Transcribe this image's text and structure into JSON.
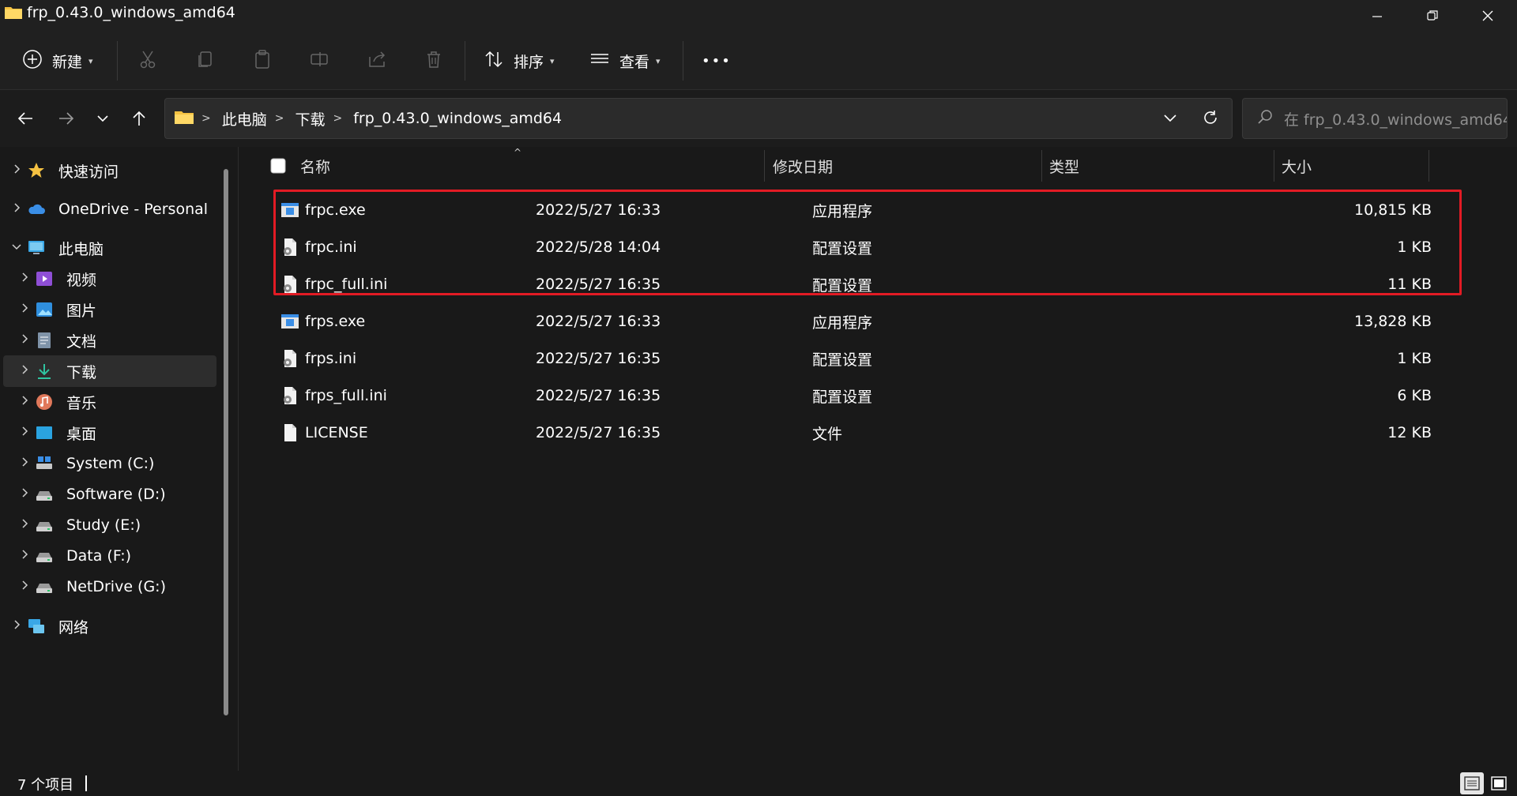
{
  "window": {
    "title": "frp_0.43.0_windows_amd64",
    "minimize_glyph": "—",
    "maximize_glyph": "❐",
    "close_glyph": "✕"
  },
  "toolbar": {
    "new_label": "新建",
    "sort_label": "排序",
    "view_label": "查看",
    "more_label": "•••",
    "chevron": "⌄"
  },
  "address": {
    "crumbs": [
      "此电脑",
      "下载",
      "frp_0.43.0_windows_amd64"
    ],
    "separator": ">",
    "search_placeholder": "在 frp_0.43.0_windows_amd64..."
  },
  "sidebar": {
    "items": [
      {
        "label": "快速访问",
        "icon": "star-icon",
        "expanded": false
      },
      {
        "label": "OneDrive - Personal",
        "icon": "cloud-icon",
        "expanded": false
      },
      {
        "label": "此电脑",
        "icon": "computer-icon",
        "expanded": true
      },
      {
        "label": "视频",
        "icon": "video-icon",
        "expanded": false
      },
      {
        "label": "图片",
        "icon": "pictures-icon",
        "expanded": false
      },
      {
        "label": "文档",
        "icon": "documents-icon",
        "expanded": false
      },
      {
        "label": "下载",
        "icon": "download-icon",
        "expanded": false,
        "selected": true
      },
      {
        "label": "音乐",
        "icon": "music-icon",
        "expanded": false
      },
      {
        "label": "桌面",
        "icon": "desktop-icon",
        "expanded": false
      },
      {
        "label": "System (C:)",
        "icon": "system-drive-icon",
        "expanded": false
      },
      {
        "label": "Software (D:)",
        "icon": "drive-icon",
        "expanded": false
      },
      {
        "label": "Study (E:)",
        "icon": "drive-icon",
        "expanded": false
      },
      {
        "label": "Data (F:)",
        "icon": "drive-icon",
        "expanded": false
      },
      {
        "label": "NetDrive (G:)",
        "icon": "drive-icon",
        "expanded": false
      },
      {
        "label": "网络",
        "icon": "network-icon",
        "expanded": false
      }
    ]
  },
  "columns": {
    "name": "名称",
    "modified": "修改日期",
    "type": "类型",
    "size": "大小"
  },
  "files": [
    {
      "name": "frpc.exe",
      "modified": "2022/5/27 16:33",
      "type": "应用程序",
      "size": "10,815 KB",
      "icon": "exe-icon"
    },
    {
      "name": "frpc.ini",
      "modified": "2022/5/28 14:04",
      "type": "配置设置",
      "size": "1 KB",
      "icon": "ini-icon"
    },
    {
      "name": "frpc_full.ini",
      "modified": "2022/5/27 16:35",
      "type": "配置设置",
      "size": "11 KB",
      "icon": "ini-icon"
    },
    {
      "name": "frps.exe",
      "modified": "2022/5/27 16:33",
      "type": "应用程序",
      "size": "13,828 KB",
      "icon": "exe-icon"
    },
    {
      "name": "frps.ini",
      "modified": "2022/5/27 16:35",
      "type": "配置设置",
      "size": "1 KB",
      "icon": "ini-icon"
    },
    {
      "name": "frps_full.ini",
      "modified": "2022/5/27 16:35",
      "type": "配置设置",
      "size": "6 KB",
      "icon": "ini-icon"
    },
    {
      "name": "LICENSE",
      "modified": "2022/5/27 16:35",
      "type": "文件",
      "size": "12 KB",
      "icon": "file-icon"
    }
  ],
  "status": {
    "item_count": "7 个项目"
  },
  "colors": {
    "highlight_border": "#e21b24",
    "folder_yellow": "#f5c242",
    "accent_blue": "#3a8ee6"
  }
}
